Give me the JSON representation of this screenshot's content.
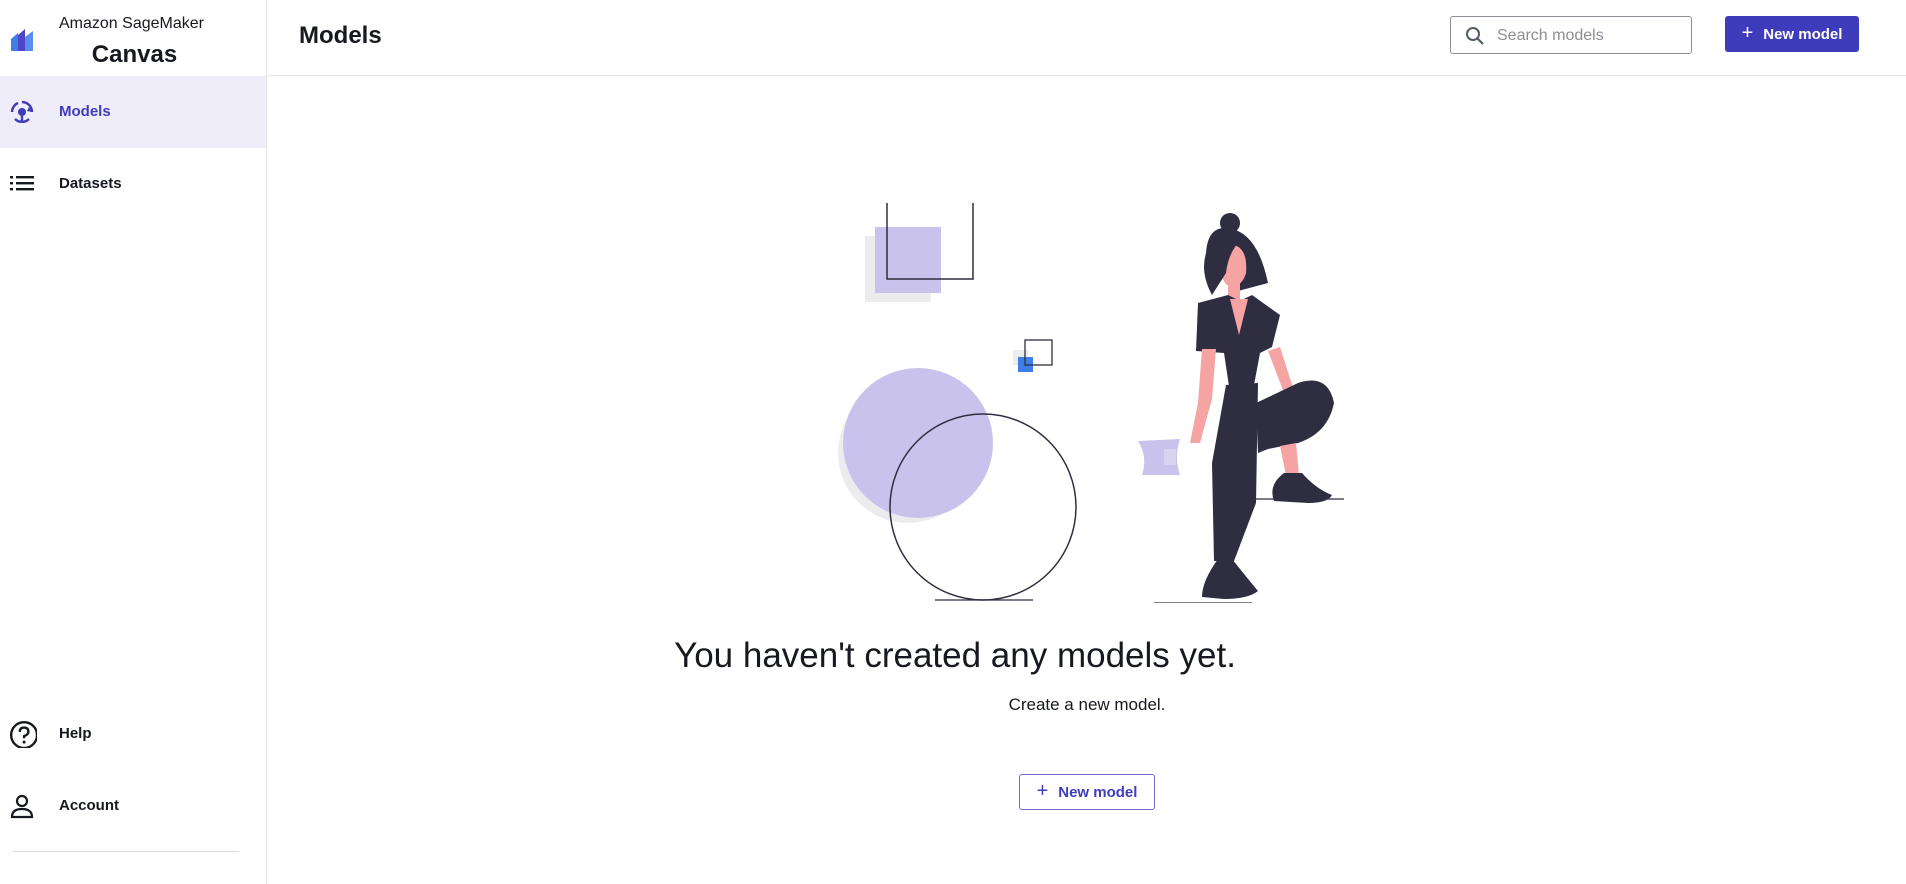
{
  "brand": {
    "top_line": "Amazon SageMaker",
    "product": "Canvas",
    "logo_icon": "sagemaker-logo"
  },
  "sidebar": {
    "items": [
      {
        "label": "Models",
        "icon": "models-icon",
        "active": true
      },
      {
        "label": "Datasets",
        "icon": "list-icon",
        "active": false
      }
    ],
    "bottom_items": [
      {
        "label": "Help",
        "icon": "help-icon"
      },
      {
        "label": "Account",
        "icon": "account-icon"
      }
    ]
  },
  "header": {
    "title": "Models",
    "search": {
      "placeholder": "Search models",
      "value": ""
    },
    "new_button": {
      "label": "New model",
      "icon": "plus-icon"
    }
  },
  "empty_state": {
    "title": "You haven't created any models yet.",
    "subtitle": "Create a new model.",
    "button": {
      "label": "New model",
      "icon": "plus-icon"
    }
  },
  "colors": {
    "accent": "#3f3cbb",
    "active_bg": "#efedfa",
    "illustration_purple": "#c9c2ec",
    "illustration_dark": "#2f2e41",
    "skin": "#f5a3a3"
  }
}
